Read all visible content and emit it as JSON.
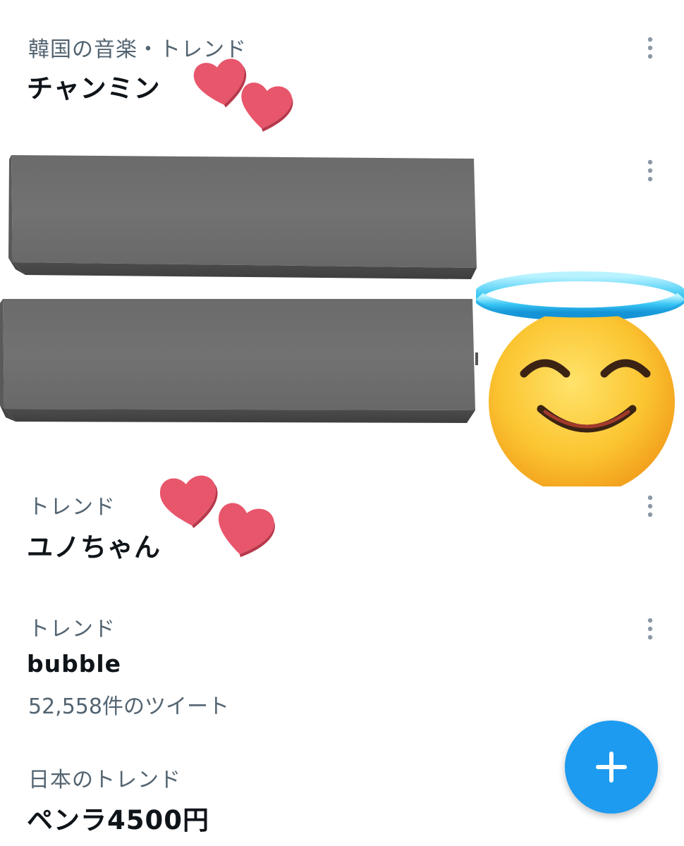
{
  "trends": [
    {
      "context": "韓国の音楽・トレンド",
      "name": "チャンミン",
      "count": ""
    },
    {
      "context": "トレンド",
      "name": "ユノちゃん",
      "count": ""
    },
    {
      "context": "トレンド",
      "name": "bubble",
      "count": "52,558件のツイート"
    },
    {
      "context": "日本のトレンド",
      "name": "ペンラ4500円",
      "count": ""
    }
  ],
  "icons": {
    "more": "more-vertical-icon",
    "compose": "plus-icon",
    "sticker_hearts": "two-hearts-icon",
    "sticker_emoji": "smiling-face-with-halo-icon"
  },
  "colors": {
    "accent": "#1d9bf0",
    "text_primary": "#0f1419",
    "text_secondary": "#536471",
    "heart": "#e8566c",
    "redaction": "#6f6f6f"
  }
}
